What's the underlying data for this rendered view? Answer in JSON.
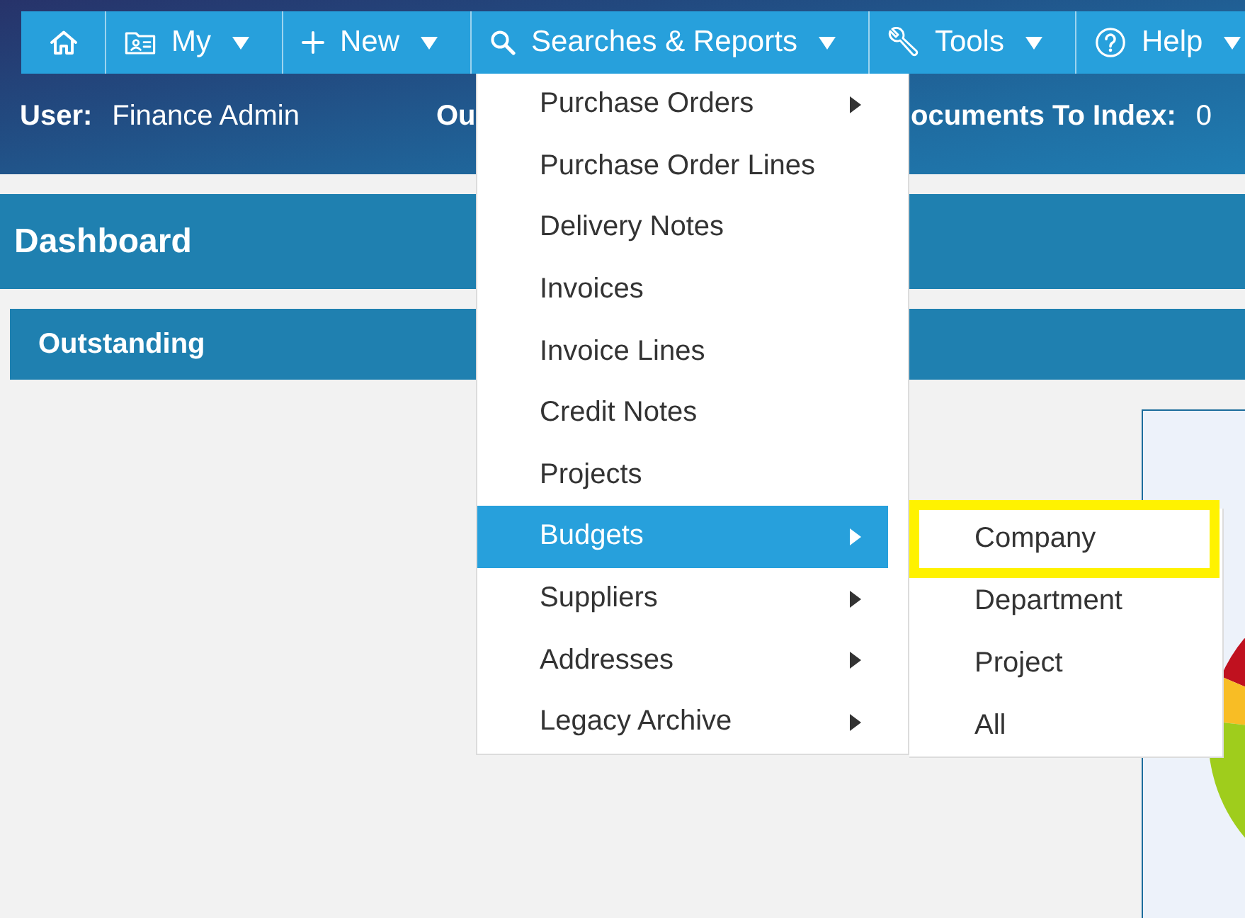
{
  "nav_bar": {
    "items": [
      {
        "kind": "home"
      },
      {
        "kind": "my",
        "label": "My",
        "has_menu": true
      },
      {
        "kind": "new",
        "label": "New",
        "has_menu": true
      },
      {
        "kind": "search",
        "label": "Searches & Reports",
        "has_menu": true
      },
      {
        "kind": "tools",
        "label": "Tools",
        "has_menu": true
      },
      {
        "kind": "help",
        "label": "Help",
        "has_menu": true
      }
    ]
  },
  "info_bar": {
    "items": [
      {
        "label": "User:",
        "value": "Finance Admin"
      },
      {
        "label": "Ou"
      },
      {
        "label": "ocuments To Index:",
        "value": "0"
      }
    ]
  },
  "dashboard": {
    "title": "Dashboard",
    "section": {
      "title": "Outstanding"
    }
  },
  "dropdown_menu": {
    "items": [
      {
        "label": "Purchase Orders",
        "has_submenu": true,
        "selected": false
      },
      {
        "label": "Purchase Order Lines",
        "has_submenu": false,
        "selected": false
      },
      {
        "label": "Delivery Notes",
        "has_submenu": false,
        "selected": false
      },
      {
        "label": "Invoices",
        "has_submenu": false,
        "selected": false
      },
      {
        "label": "Invoice Lines",
        "has_submenu": false,
        "selected": false
      },
      {
        "label": "Credit Notes",
        "has_submenu": false,
        "selected": false
      },
      {
        "label": "Projects",
        "has_submenu": false,
        "selected": false
      },
      {
        "label": "Budgets",
        "has_submenu": true,
        "selected": true
      },
      {
        "label": "Suppliers",
        "has_submenu": true,
        "selected": false
      },
      {
        "label": "Addresses",
        "has_submenu": true,
        "selected": false
      },
      {
        "label": "Legacy Archive",
        "has_submenu": true,
        "selected": false
      }
    ]
  },
  "submenu": {
    "items": [
      {
        "label": "Company",
        "selected": false,
        "highlighted": true
      },
      {
        "label": "Department",
        "selected": false,
        "highlighted": false
      },
      {
        "label": "Project",
        "selected": false,
        "highlighted": false
      },
      {
        "label": "All",
        "selected": false,
        "highlighted": false
      }
    ]
  }
}
